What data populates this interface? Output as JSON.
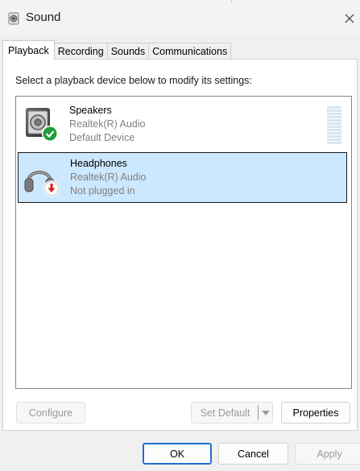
{
  "window": {
    "title": "Sound",
    "icon": "speaker-app-icon",
    "close_icon": "close-icon"
  },
  "tabs": [
    {
      "label": "Playback",
      "active": true
    },
    {
      "label": "Recording",
      "active": false
    },
    {
      "label": "Sounds",
      "active": false
    },
    {
      "label": "Communications",
      "active": false
    }
  ],
  "playback": {
    "instruction": "Select a playback device below to modify its settings:",
    "devices": [
      {
        "name": "Speakers",
        "driver": "Realtek(R) Audio",
        "status": "Default Device",
        "icon": "speaker-icon",
        "badge": "green-check-icon",
        "selected": false,
        "level": 0
      },
      {
        "name": "Headphones",
        "driver": "Realtek(R) Audio",
        "status": "Not plugged in",
        "icon": "headphones-icon",
        "badge": "red-down-arrow-icon",
        "selected": true
      }
    ],
    "buttons": {
      "configure": "Configure",
      "set_default": "Set Default",
      "properties": "Properties"
    }
  },
  "footer": {
    "ok": "OK",
    "cancel": "Cancel",
    "apply": "Apply"
  },
  "colors": {
    "selection": "#cce8ff",
    "check_green": "#1f9e3a",
    "badge_red": "#d32020",
    "primary_border": "#1e6fd0"
  }
}
